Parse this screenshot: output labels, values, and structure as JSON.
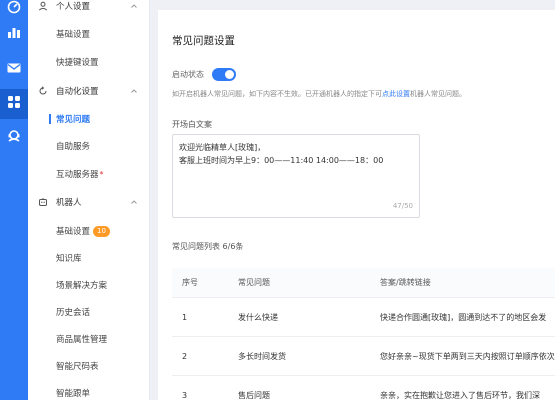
{
  "rail": {
    "items": [
      {
        "icon": "dashboard-icon"
      },
      {
        "icon": "chart-icon"
      },
      {
        "icon": "mail-icon"
      },
      {
        "icon": "apps-icon",
        "active": true
      },
      {
        "icon": "customer-service-icon"
      }
    ]
  },
  "menu": {
    "groups": [
      {
        "label": "个人设置",
        "icon": "user-icon",
        "items": [
          {
            "label": "基础设置"
          },
          {
            "label": "快捷键设置"
          }
        ]
      },
      {
        "label": "自动化设置",
        "icon": "refresh-icon",
        "items": [
          {
            "label": "常见问题",
            "active": true
          },
          {
            "label": "自助服务"
          },
          {
            "label": "互动服务器",
            "required_mark": "*"
          }
        ]
      },
      {
        "label": "机器人",
        "icon": "robot-icon",
        "items": [
          {
            "label": "基础设置",
            "badge": "10"
          },
          {
            "label": "知识库"
          },
          {
            "label": "场景解决方案"
          },
          {
            "label": "历史会话"
          },
          {
            "label": "商品属性管理"
          },
          {
            "label": "智能尺码表"
          },
          {
            "label": "智能跟单"
          }
        ]
      }
    ]
  },
  "main": {
    "title": "常见问题设置",
    "toggle_label": "启动状态",
    "hint_prefix": "如开启机器人常见问题，如下内容不生效。已开通机器人的指定下可",
    "hint_link": "点此设置",
    "hint_suffix": "机器人常见问题。",
    "welcome_label": "开场白文案",
    "welcome_lines": [
      "欢迎光临精草人[玫瑰]，",
      "客服上班时间为早上9：00——11:40  14:00——18：00"
    ],
    "counter": "47/50",
    "list_title": "常见问题列表 6/6条",
    "table": {
      "headers": [
        "序号",
        "常见问题",
        "答案/跳转链接"
      ],
      "rows": [
        [
          "1",
          "发什么快递",
          "快递合作圆通[玫瑰]，圆通到达不了的地区会发"
        ],
        [
          "2",
          "多长时间发货",
          "您好亲亲~现货下单两到三天内按照订单顺序依次"
        ],
        [
          "3",
          "售后问题",
          "亲亲，实在抱歉让您进入了售后环节，我们深"
        ]
      ]
    }
  },
  "colors": {
    "accent": "#2f7bf5",
    "rail_bg": "#2f7bf5",
    "badge": "#ff9a26",
    "required": "#e5322d"
  }
}
